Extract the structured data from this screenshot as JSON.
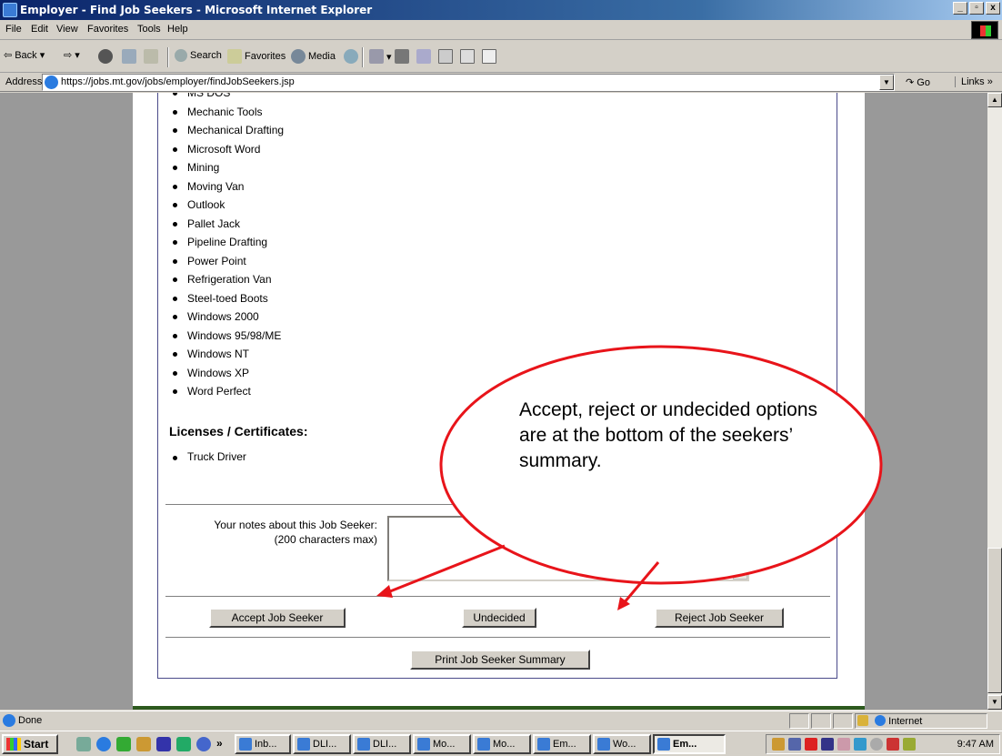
{
  "window": {
    "title": "Employer - Find Job Seekers - Microsoft Internet Explorer",
    "buttons": [
      "_",
      "̅",
      "x"
    ]
  },
  "menu": [
    "File",
    "Edit",
    "View",
    "Favorites",
    "Tools",
    "Help"
  ],
  "toolbar": {
    "back": "Back",
    "search": "Search",
    "favorites": "Favorites",
    "media": "Media"
  },
  "address": {
    "label": "Address",
    "url": "https://jobs.mt.gov/jobs/employer/findJobSeekers.jsp",
    "go": "Go",
    "links": "Links"
  },
  "skills": [
    "MS DOS",
    "Mechanic Tools",
    "Mechanical Drafting",
    "Microsoft Word",
    "Mining",
    "Moving Van",
    "Outlook",
    "Pallet Jack",
    "Pipeline Drafting",
    "Power Point",
    "Refrigeration Van",
    "Steel-toed Boots",
    "Windows 2000",
    "Windows 95/98/ME",
    "Windows NT",
    "Windows XP",
    "Word Perfect"
  ],
  "licenses": {
    "heading": "Licenses / Certificates:",
    "items": [
      "Truck Driver"
    ]
  },
  "notes": {
    "label_line1": "Your notes about this Job Seeker:",
    "label_line2": "(200 characters max)",
    "value": ""
  },
  "actions": {
    "accept": "Accept Job Seeker",
    "undecided": "Undecided",
    "reject": "Reject Job Seeker",
    "print": "Print Job Seeker Summary"
  },
  "callout": {
    "text": "Accept, reject or undecided options are at the bottom of the seekers’ summary.",
    "color": "#e8141a"
  },
  "status": {
    "text": "Done",
    "zone": "Internet"
  },
  "taskbar": {
    "start": "Start",
    "chevron": "»",
    "tasks": [
      "Inb...",
      "DLI...",
      "DLI...",
      "Mo...",
      "Mo...",
      "Em...",
      "Wo...",
      "Em..."
    ],
    "clock": "9:47 AM"
  }
}
